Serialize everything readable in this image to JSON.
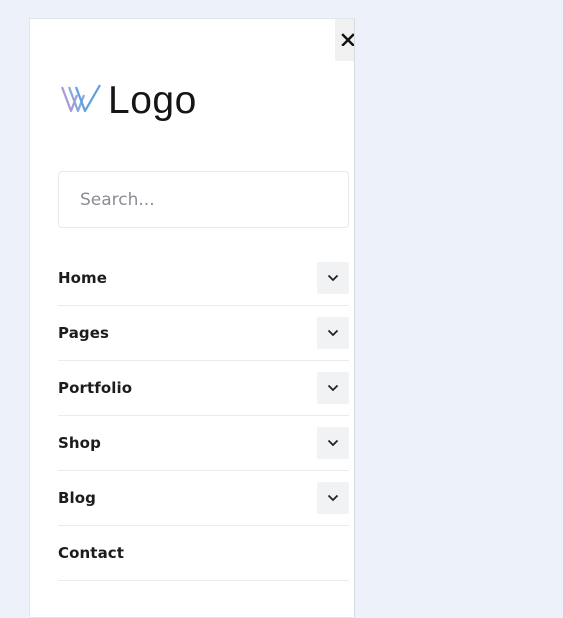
{
  "logo": {
    "text": "Logo",
    "icon": "logo-mark-icon",
    "colors": {
      "mark_left": "#a89ad6",
      "mark_right": "#5f9ee0"
    }
  },
  "close": {
    "icon": "close-icon"
  },
  "search": {
    "placeholder": "Search..."
  },
  "menu": {
    "items": [
      {
        "label": "Home",
        "has_submenu": true,
        "icon": "chevron-down-icon"
      },
      {
        "label": "Pages",
        "has_submenu": true,
        "icon": "chevron-down-icon"
      },
      {
        "label": "Portfolio",
        "has_submenu": true,
        "icon": "chevron-down-icon"
      },
      {
        "label": "Shop",
        "has_submenu": true,
        "icon": "chevron-down-icon"
      },
      {
        "label": "Blog",
        "has_submenu": true,
        "icon": "chevron-down-icon"
      },
      {
        "label": "Contact",
        "has_submenu": false
      }
    ]
  }
}
